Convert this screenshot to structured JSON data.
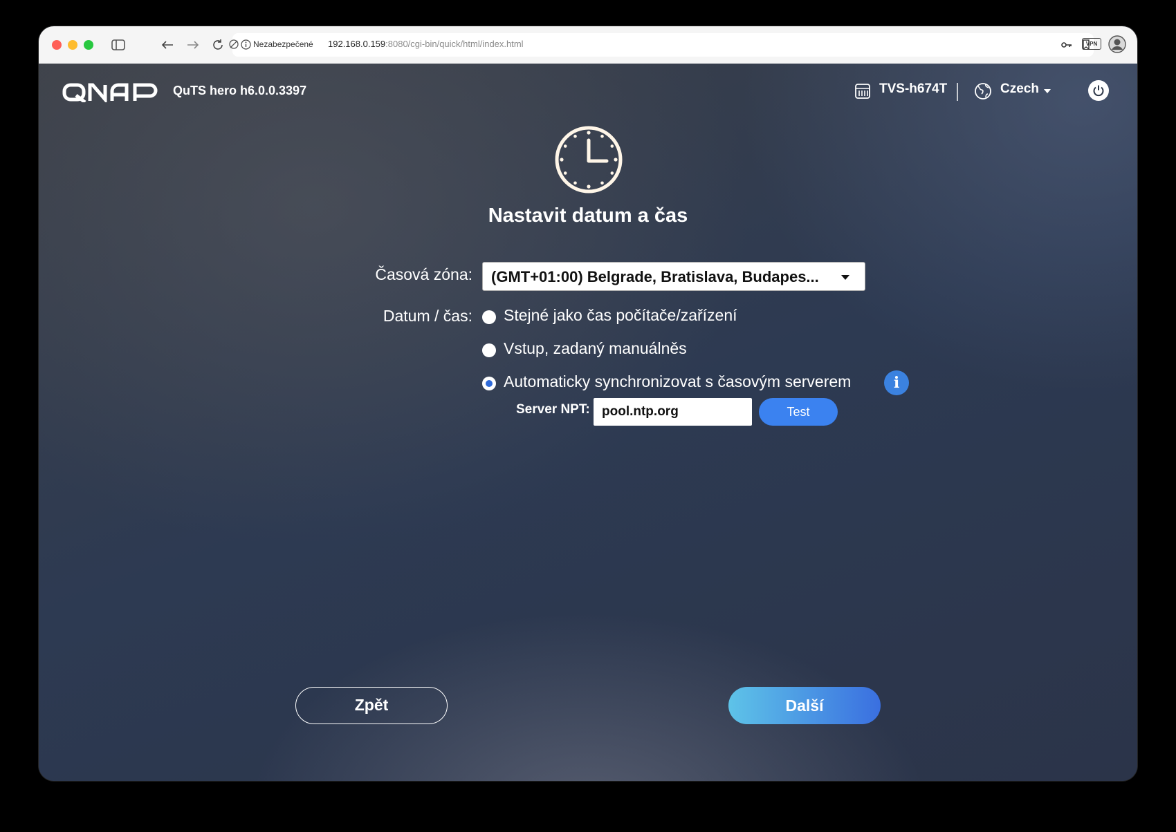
{
  "browser": {
    "security_label": "Nezabezpečené",
    "url_host": "192.168.0.159",
    "url_rest": ":8080/cgi-bin/quick/html/index.html",
    "vpn_label": "VPN"
  },
  "header": {
    "logo_text": "QNAP",
    "product": "QuTS hero h6.0.0.3397",
    "model": "TVS-h674T",
    "language": "Czech"
  },
  "main": {
    "title": "Nastavit datum a čas",
    "timezone_label": "Časová zóna:",
    "timezone_value": "(GMT+01:00) Belgrade, Bratislava, Budapes...",
    "datetime_label": "Datum / čas:",
    "options": [
      {
        "label": "Stejné jako čas počítače/zařízení",
        "selected": false
      },
      {
        "label": "Vstup, zadaný manuálněs",
        "selected": false
      },
      {
        "label": "Automaticky synchronizovat s časovým serverem",
        "selected": true
      }
    ],
    "ntp_label": "Server NPT:",
    "ntp_value": "pool.ntp.org",
    "test_label": "Test",
    "info_glyph": "i"
  },
  "footer": {
    "back_label": "Zpět",
    "next_label": "Další"
  },
  "colors": {
    "accent": "#3b82f0",
    "next_gradient_start": "#5ec3e8",
    "next_gradient_end": "#3a6fe0"
  }
}
